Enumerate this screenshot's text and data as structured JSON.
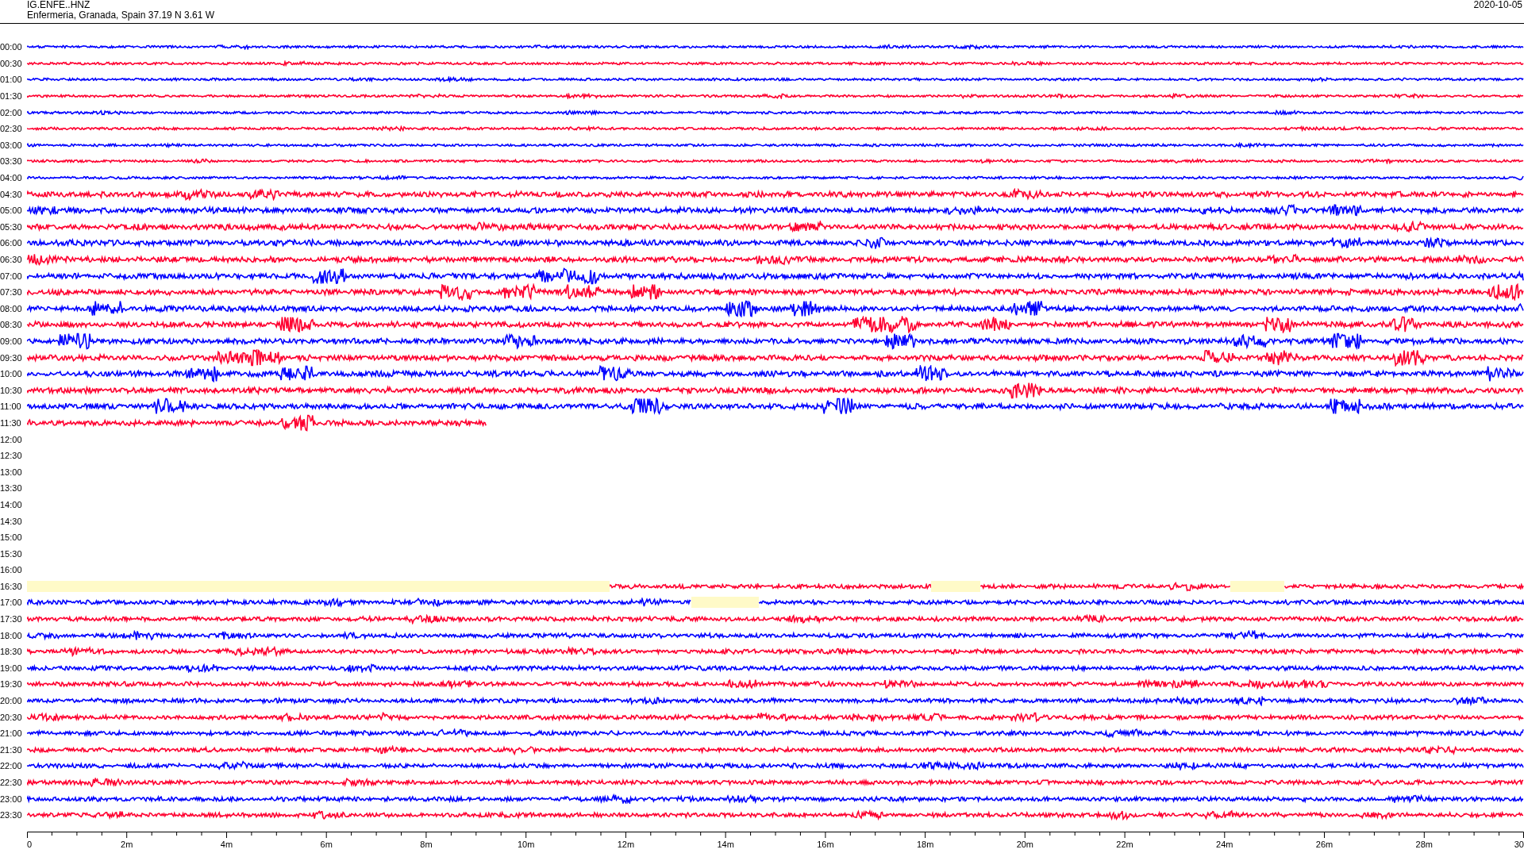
{
  "header": {
    "station": "IG.ENFE..HNZ",
    "location": "Enfermeria, Granada, Spain  37.19 N 3.61 W",
    "date": "2020-10-05"
  },
  "rows": [
    {
      "time": "00:00",
      "kind": "full",
      "color": "#0000ff"
    },
    {
      "time": "00:30",
      "kind": "full",
      "color": "#ff0030"
    },
    {
      "time": "01:00",
      "kind": "full",
      "color": "#0000ff"
    },
    {
      "time": "01:30",
      "kind": "full",
      "color": "#ff0030"
    },
    {
      "time": "02:00",
      "kind": "full",
      "color": "#0000ff"
    },
    {
      "time": "02:30",
      "kind": "full",
      "color": "#ff0030"
    },
    {
      "time": "03:00",
      "kind": "full",
      "color": "#0000ff"
    },
    {
      "time": "03:30",
      "kind": "full",
      "color": "#ff0030"
    },
    {
      "time": "04:00",
      "kind": "full",
      "color": "#0000ff"
    },
    {
      "time": "04:30",
      "kind": "full",
      "color": "#ff0030"
    },
    {
      "time": "05:00",
      "kind": "full",
      "color": "#0000ff"
    },
    {
      "time": "05:30",
      "kind": "full",
      "color": "#ff0030"
    },
    {
      "time": "06:00",
      "kind": "full",
      "color": "#0000ff"
    },
    {
      "time": "06:30",
      "kind": "full",
      "color": "#ff0030"
    },
    {
      "time": "07:00",
      "kind": "full",
      "color": "#0000ff"
    },
    {
      "time": "07:30",
      "kind": "full",
      "color": "#ff0030"
    },
    {
      "time": "08:00",
      "kind": "full",
      "color": "#0000ff"
    },
    {
      "time": "08:30",
      "kind": "full",
      "color": "#ff0030"
    },
    {
      "time": "09:00",
      "kind": "full",
      "color": "#0000ff"
    },
    {
      "time": "09:30",
      "kind": "full",
      "color": "#ff0030"
    },
    {
      "time": "10:00",
      "kind": "full",
      "color": "#0000ff"
    },
    {
      "time": "10:30",
      "kind": "full",
      "color": "#ff0030"
    },
    {
      "time": "11:00",
      "kind": "full",
      "color": "#0000ff"
    },
    {
      "time": "11:30",
      "kind": "partial",
      "color": "#ff0030"
    },
    {
      "time": "12:00",
      "kind": "none"
    },
    {
      "time": "12:30",
      "kind": "none"
    },
    {
      "time": "13:00",
      "kind": "none"
    },
    {
      "time": "13:30",
      "kind": "none"
    },
    {
      "time": "14:00",
      "kind": "none"
    },
    {
      "time": "14:30",
      "kind": "none"
    },
    {
      "time": "15:00",
      "kind": "none"
    },
    {
      "time": "15:30",
      "kind": "none"
    },
    {
      "time": "16:00",
      "kind": "none"
    },
    {
      "time": "16:30",
      "kind": "gapped",
      "color": "#ff0030"
    },
    {
      "time": "17:00",
      "kind": "gapped",
      "color": "#0000ff"
    },
    {
      "time": "17:30",
      "kind": "full",
      "color": "#ff0030"
    },
    {
      "time": "18:00",
      "kind": "full",
      "color": "#0000ff"
    },
    {
      "time": "18:30",
      "kind": "full",
      "color": "#ff0030"
    },
    {
      "time": "19:00",
      "kind": "full",
      "color": "#0000ff"
    },
    {
      "time": "19:30",
      "kind": "full",
      "color": "#ff0030"
    },
    {
      "time": "20:00",
      "kind": "full",
      "color": "#0000ff"
    },
    {
      "time": "20:30",
      "kind": "full",
      "color": "#ff0030"
    },
    {
      "time": "21:00",
      "kind": "full",
      "color": "#0000ff"
    },
    {
      "time": "21:30",
      "kind": "full",
      "color": "#ff0030"
    },
    {
      "time": "22:00",
      "kind": "full",
      "color": "#0000ff"
    },
    {
      "time": "22:30",
      "kind": "full",
      "color": "#ff0030"
    },
    {
      "time": "23:00",
      "kind": "full",
      "color": "#0000ff"
    },
    {
      "time": "23:30",
      "kind": "full",
      "color": "#ff0030"
    }
  ],
  "axis": {
    "ticks": [
      "0",
      "2m",
      "4m",
      "6m",
      "8m",
      "10m",
      "12m",
      "14m",
      "16m",
      "18m",
      "20m",
      "22m",
      "24m",
      "26m",
      "28m",
      "30"
    ]
  }
}
